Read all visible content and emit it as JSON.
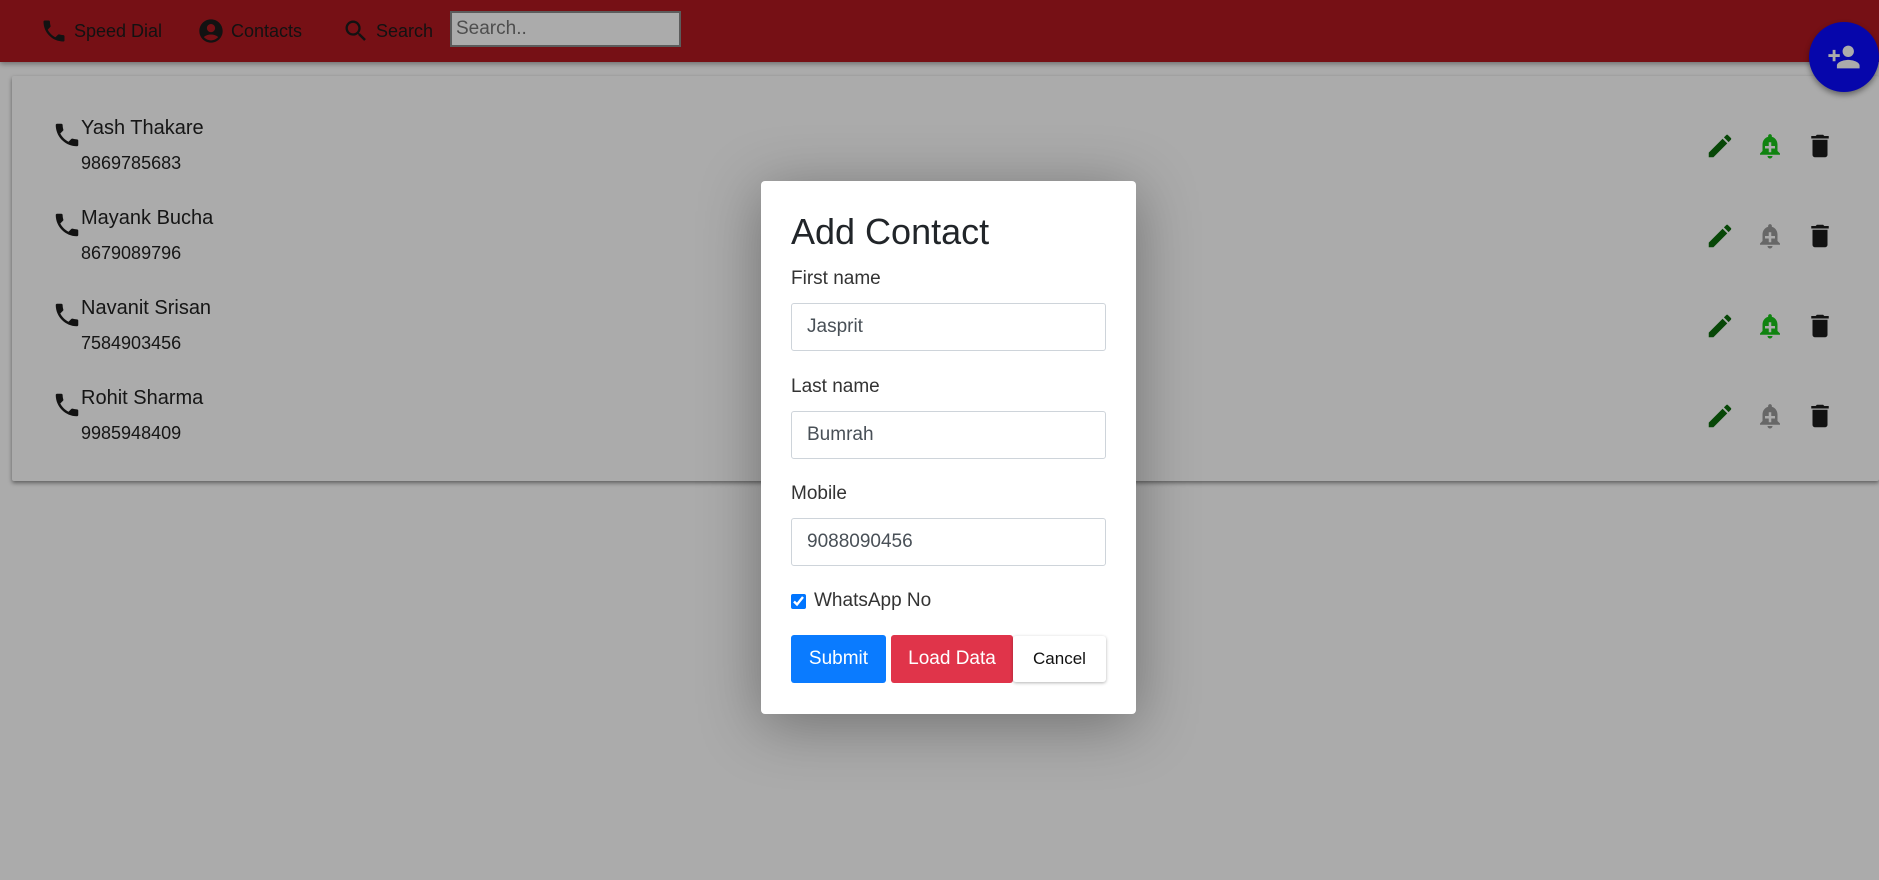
{
  "navbar": {
    "speed_dial_label": "Speed Dial",
    "contacts_label": "Contacts",
    "search_label": "Search",
    "search_placeholder": "Search..",
    "search_value": ""
  },
  "contacts": [
    {
      "name": "Yash Thakare",
      "phone": "9869785683",
      "alert_active": true
    },
    {
      "name": "Mayank Bucha",
      "phone": "8679089796",
      "alert_active": false
    },
    {
      "name": "Navanit Srisan",
      "phone": "7584903456",
      "alert_active": true
    },
    {
      "name": "Rohit Sharma",
      "phone": "9985948409",
      "alert_active": false
    }
  ],
  "icons": {
    "speed_dial": "phone-icon",
    "contacts": "account-circle-icon",
    "search": "search-icon",
    "row_phone": "phone-icon",
    "edit": "pencil-icon",
    "alert": "bell-plus-icon",
    "delete": "trash-icon",
    "fab": "person-add-icon"
  },
  "colors": {
    "appbar": "#b01820",
    "fab": "#0a0aff",
    "edit_icon": "#0b6b0b",
    "alert_active": "#19c419",
    "alert_inactive": "#9a9a9a",
    "delete_icon": "#1b1b1b",
    "submit_button": "#0a7bff",
    "load_button": "#e0344a"
  },
  "modal": {
    "title": "Add Contact",
    "first_name_label": "First name",
    "first_name_value": "Jasprit",
    "last_name_label": "Last name",
    "last_name_value": "Bumrah",
    "mobile_label": "Mobile",
    "mobile_value": "9088090456",
    "whatsapp_label": "WhatsApp No",
    "whatsapp_checked": true,
    "submit_label": "Submit",
    "load_label": "Load Data",
    "cancel_label": "Cancel"
  }
}
